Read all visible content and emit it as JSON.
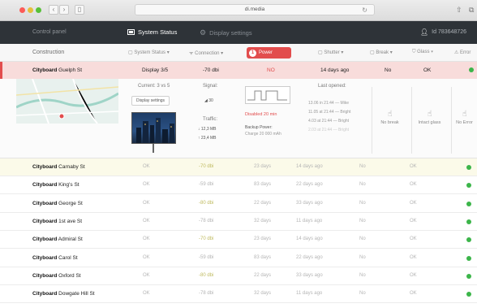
{
  "browser": {
    "url": "di.media"
  },
  "appbar": {
    "crumb": "Control panel",
    "tabs": [
      {
        "label": "System Status",
        "active": true,
        "icon": "monitor-icon"
      },
      {
        "label": "Display settings",
        "active": false,
        "icon": "gear-icon"
      }
    ],
    "user_id": "Id 783648726"
  },
  "filterbar": {
    "label": "Construction",
    "filters": [
      {
        "label": "System Status",
        "icon": "square-icon"
      },
      {
        "label": "Connection",
        "icon": "wifi-icon"
      },
      {
        "label": "Shutter",
        "icon": "square-icon"
      },
      {
        "label": "Break",
        "icon": "square-icon"
      },
      {
        "label": "Glass",
        "icon": "shield-icon"
      },
      {
        "label": "Error",
        "icon": "warning-icon"
      }
    ],
    "power_filter": {
      "count": "1",
      "label": "Power"
    }
  },
  "selected_row": {
    "brand": "Cityboard",
    "street": "Guelph St",
    "display": "Display 3/5",
    "signal": "-70 dbi",
    "power": "NO",
    "last_opened": "14 days ago",
    "break": "No",
    "glass": "OK"
  },
  "detail": {
    "current": "Current: 3 vs 5",
    "display_settings_button": "Display settings",
    "signal_label": "Signal:",
    "signal_value": "30",
    "traffic_label": "Traffic:",
    "traffic_down": "12,3 MB",
    "traffic_up": "23,4 MB",
    "disabled": "Disabled 20 min",
    "backup_label": "Backup Power:",
    "backup_value": "Charge 20 000 mAh",
    "last_opened_label": "Last opened:",
    "openings": [
      "13.06 in 21:44 — Mike",
      "11.05 at 21:44 — Bright",
      "4.03 at 21:44 — Bright",
      "2.03 at 21:44 — Bright"
    ],
    "sensors": [
      "No break",
      "Intact glass",
      "No Error"
    ]
  },
  "table": {
    "rows": [
      {
        "brand": "Cityboard",
        "street": "Carnaby St",
        "status": "OK",
        "signal": "-70 dbi",
        "days": "23 days",
        "opened": "14 days ago",
        "break": "No",
        "glass": "OK",
        "olive": true
      },
      {
        "brand": "Cityboard",
        "street": "King's St",
        "status": "OK",
        "signal": "-59 dbi",
        "days": "83 days",
        "opened": "22 days ago",
        "break": "No",
        "glass": "OK",
        "olive": false
      },
      {
        "brand": "Cityboard",
        "street": "George St",
        "status": "OK",
        "signal": "-80 dbi",
        "days": "22 days",
        "opened": "33 days ago",
        "break": "No",
        "glass": "OK",
        "olive": true
      },
      {
        "brand": "Cityboard",
        "street": "1st ave St",
        "status": "OK",
        "signal": "-78 dbi",
        "days": "32 days",
        "opened": "11 days ago",
        "break": "No",
        "glass": "OK",
        "olive": false
      },
      {
        "brand": "Cityboard",
        "street": "Admiral St",
        "status": "OK",
        "signal": "-70 dbi",
        "days": "23 days",
        "opened": "14 days ago",
        "break": "No",
        "glass": "OK",
        "olive": true
      },
      {
        "brand": "Cityboard",
        "street": "Carol St",
        "status": "OK",
        "signal": "-59 dbi",
        "days": "83 days",
        "opened": "22 days ago",
        "break": "No",
        "glass": "OK",
        "olive": false
      },
      {
        "brand": "Cityboard",
        "street": "Oxford St",
        "status": "OK",
        "signal": "-80 dbi",
        "days": "22 days",
        "opened": "33 days ago",
        "break": "No",
        "glass": "OK",
        "olive": true
      },
      {
        "brand": "Cityboard",
        "street": "Dowgate Hill St",
        "status": "OK",
        "signal": "-78 dbi",
        "days": "32 days",
        "opened": "11 days ago",
        "break": "No",
        "glass": "OK",
        "olive": false
      }
    ]
  },
  "colors": {
    "accent_red": "#e24d4d",
    "status_green": "#3cb54a",
    "header_bg": "#2e3338"
  }
}
